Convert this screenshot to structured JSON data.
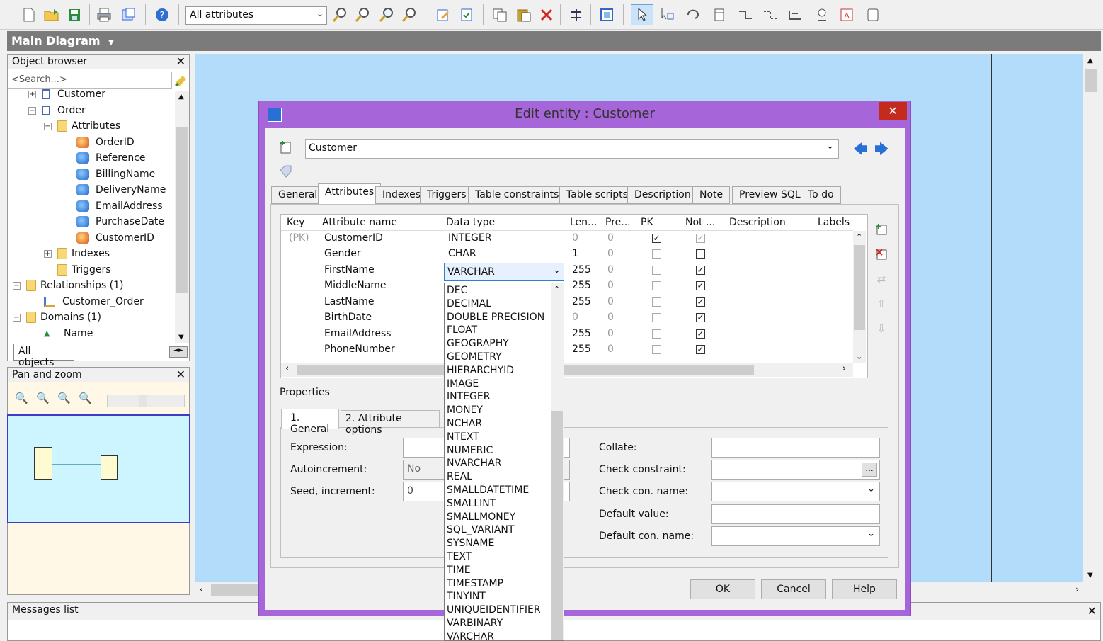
{
  "toolbar": {
    "attribute_filter": "All attributes"
  },
  "diagram": {
    "title": "Main Diagram"
  },
  "object_browser": {
    "title": "Object browser",
    "search_placeholder": "<Search...>",
    "tree": [
      {
        "label": "Customer"
      },
      {
        "label": "Order"
      },
      {
        "label": "Attributes"
      },
      {
        "label": "OrderID"
      },
      {
        "label": "Reference"
      },
      {
        "label": "BillingName"
      },
      {
        "label": "DeliveryName"
      },
      {
        "label": "EmailAddress"
      },
      {
        "label": "PurchaseDate"
      },
      {
        "label": "CustomerID"
      },
      {
        "label": "Indexes"
      },
      {
        "label": "Triggers"
      },
      {
        "label": "Relationships (1)"
      },
      {
        "label": "Customer_Order"
      },
      {
        "label": "Domains (1)"
      },
      {
        "label": "Name"
      }
    ],
    "bottom_tab": "All objects"
  },
  "pan_zoom": {
    "title": "Pan and zoom",
    "zoom_level": 0.4
  },
  "messages": {
    "title": "Messages list"
  },
  "dialog": {
    "title": "Edit entity : Customer",
    "entity_name": "Customer",
    "tabs": [
      "General",
      "Attributes",
      "Indexes",
      "Triggers",
      "Table constraints",
      "Table scripts",
      "Description",
      "Note",
      "Preview SQL",
      "To do"
    ],
    "active_tab": "Attributes",
    "columns": [
      "Key",
      "Attribute name",
      "Data type",
      "Len...",
      "Pre...",
      "PK",
      "Not ...",
      "Description",
      "Labels"
    ],
    "rows": [
      {
        "key": "(PK)",
        "name": "CustomerID",
        "type": "INTEGER",
        "len": "0",
        "pre": "0",
        "pk": true,
        "nn": true,
        "nn_disabled": true
      },
      {
        "key": "",
        "name": "Gender",
        "type": "CHAR",
        "len": "1",
        "pre": "0",
        "pk": false,
        "nn": false
      },
      {
        "key": "",
        "name": "FirstName",
        "type": "VARCHAR",
        "len": "255",
        "pre": "0",
        "pk": false,
        "nn": true
      },
      {
        "key": "",
        "name": "MiddleName",
        "type": "",
        "len": "255",
        "pre": "0",
        "pk": false,
        "nn": true
      },
      {
        "key": "",
        "name": "LastName",
        "type": "",
        "len": "255",
        "pre": "0",
        "pk": false,
        "nn": true
      },
      {
        "key": "",
        "name": "BirthDate",
        "type": "",
        "len": "0",
        "pre": "0",
        "pk": false,
        "nn": true
      },
      {
        "key": "",
        "name": "EmailAddress",
        "type": "",
        "len": "255",
        "pre": "0",
        "pk": false,
        "nn": true
      },
      {
        "key": "",
        "name": "PhoneNumber",
        "type": "",
        "len": "255",
        "pre": "0",
        "pk": false,
        "nn": true
      }
    ],
    "type_dropdown": {
      "selected": "VARCHAR",
      "options": [
        "DEC",
        "DECIMAL",
        "DOUBLE PRECISION",
        "FLOAT",
        "GEOGRAPHY",
        "GEOMETRY",
        "HIERARCHYID",
        "IMAGE",
        "INTEGER",
        "MONEY",
        "NCHAR",
        "NTEXT",
        "NUMERIC",
        "NVARCHAR",
        "REAL",
        "SMALLDATETIME",
        "SMALLINT",
        "SMALLMONEY",
        "SQL_VARIANT",
        "SYSNAME",
        "TEXT",
        "TIME",
        "TIMESTAMP",
        "TINYINT",
        "UNIQUEIDENTIFIER",
        "VARBINARY",
        "VARCHAR"
      ]
    },
    "properties": {
      "title": "Properties",
      "tabs": [
        "1. General",
        "2. Attribute options"
      ],
      "expression_label": "Expression:",
      "autoincrement_label": "Autoincrement:",
      "autoincrement_value": "No",
      "seed_label": "Seed, increment:",
      "seed_value": "0",
      "collate_label": "Collate:",
      "check_constraint_label": "Check constraint:",
      "check_con_name_label": "Check con. name:",
      "default_value_label": "Default value:",
      "default_con_name_label": "Default con. name:",
      "ellipsis": "..."
    },
    "buttons": {
      "ok": "OK",
      "cancel": "Cancel",
      "help": "Help"
    }
  }
}
